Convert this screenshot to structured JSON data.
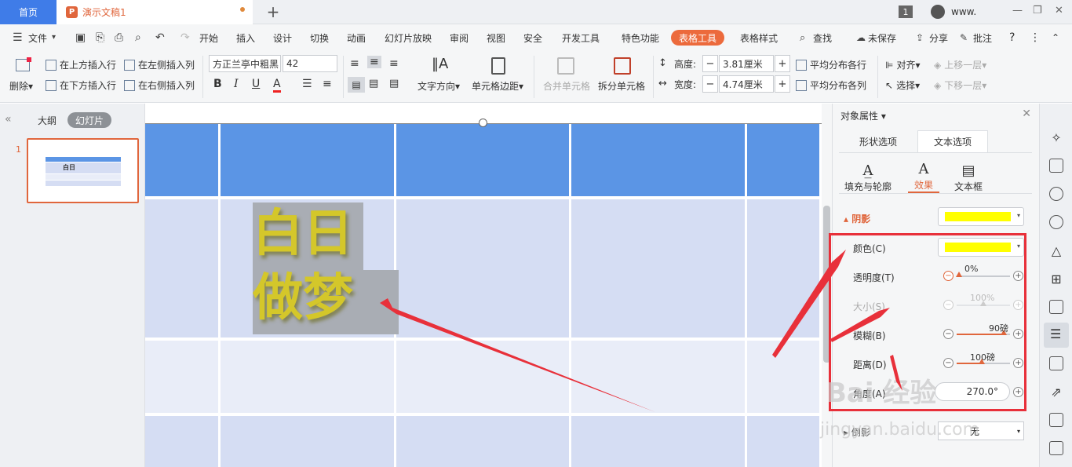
{
  "titlebar": {
    "home_tab": "首页",
    "doc_tab": "演示文稿1",
    "doc_logo": "P",
    "add_tab": "+",
    "window_badge": "1",
    "user_name": "www.",
    "window_controls": [
      "—",
      "❐",
      "✕"
    ]
  },
  "menubar": {
    "file": "文件",
    "items": [
      "开始",
      "插入",
      "设计",
      "切换",
      "动画",
      "幻灯片放映",
      "审阅",
      "视图",
      "安全",
      "开发工具",
      "特色功能",
      "表格工具",
      "表格样式"
    ],
    "active_item": "表格工具",
    "search": "查找",
    "unsaved": "未保存",
    "share": "分享",
    "comment": "批注",
    "help": "?",
    "more": "⋮",
    "collapse": "⌃"
  },
  "ribbon": {
    "delete": "删除",
    "insert_above": "在上方插入行",
    "insert_below": "在下方插入行",
    "insert_left": "在左侧插入列",
    "insert_right": "在右侧插入列",
    "font_name": "方正兰亭中粗黑",
    "font_size": "42",
    "bold": "B",
    "italic": "I",
    "underline": "U",
    "font_color": "A",
    "text_direction": "文字方向",
    "cell_margin": "单元格边距",
    "merge_cells": "合并单元格",
    "split_cells": "拆分单元格",
    "height_label": "高度:",
    "height_value": "3.81厘米",
    "width_label": "宽度:",
    "width_value": "4.74厘米",
    "distribute_rows": "平均分布各行",
    "distribute_cols": "平均分布各列",
    "align": "对齐",
    "select": "选择",
    "bring_forward": "上移一层",
    "send_backward": "下移一层"
  },
  "left_panel": {
    "outline": "大纲",
    "slides": "幻灯片",
    "slide_number": "1"
  },
  "slide": {
    "text_line1": "白日",
    "text_line2": "做梦",
    "header_color": "#5b95e5",
    "band_color": "#d5ddf3",
    "light_color": "#e9edf8"
  },
  "properties": {
    "title": "对象属性",
    "tab_shape": "形状选项",
    "tab_text": "文本选项",
    "sub_fill": "填充与轮廓",
    "sub_effect": "效果",
    "sub_textbox": "文本框",
    "section_shadow": "阴影",
    "shadow_color": "#ffff00",
    "color_label": "颜色(C)",
    "transparency_label": "透明度(T)",
    "transparency_value": "0%",
    "transparency_level": 0,
    "size_label": "大小(S)",
    "size_value": "100%",
    "blur_label": "模糊(B)",
    "blur_value": "90磅",
    "distance_label": "距离(D)",
    "distance_value": "100磅",
    "angle_label": "角度(A)",
    "angle_value": "270.0°",
    "reflection_label": "倒影",
    "reflection_value": "无"
  },
  "watermark": {
    "brand": "Bai 经验",
    "url": "jingyan.baidu.com"
  }
}
